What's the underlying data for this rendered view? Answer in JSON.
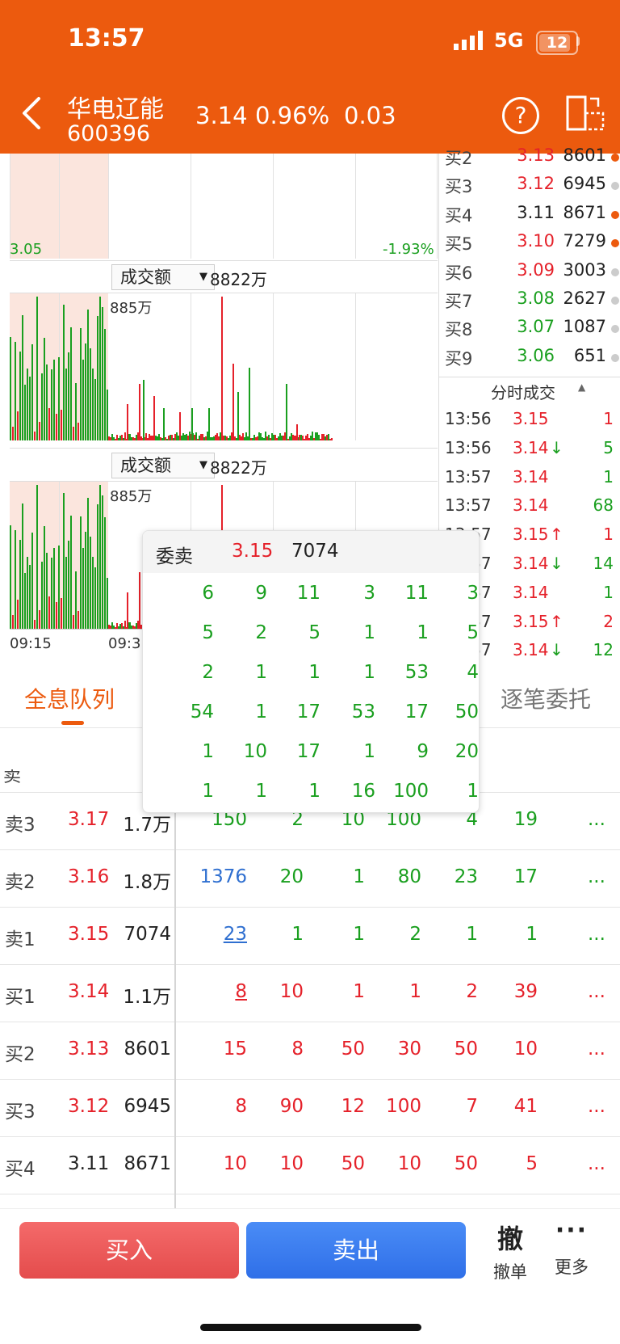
{
  "status": {
    "time": "13:57",
    "network": "5G",
    "battery": "12"
  },
  "stock": {
    "name": "华电辽能",
    "code": "600396",
    "price": "3.14",
    "change_pct": "0.96%",
    "change": "0.03"
  },
  "icons": {
    "back": "back-chevron-icon",
    "help": "help-icon",
    "switch": "landscape-switch-icon"
  },
  "chart": {
    "low_price_label": "3.05",
    "low_pct_label": "-1.93%",
    "indicator_label": "成交额",
    "indicator_value": "8822万",
    "axis_max_label": "885万",
    "time_start": "09:15",
    "time_next": "09:3"
  },
  "orderbook": [
    {
      "label": "买2",
      "price": "3.13",
      "vol": "8601",
      "dot": "#ec5a0e"
    },
    {
      "label": "买3",
      "price": "3.12",
      "vol": "6945",
      "dot": "#cccccc"
    },
    {
      "label": "买4",
      "price": "3.11",
      "vol": "8671",
      "dot": "#ec5a0e"
    },
    {
      "label": "买5",
      "price": "3.10",
      "vol": "7279",
      "dot": "#ec5a0e"
    },
    {
      "label": "买6",
      "price": "3.09",
      "vol": "3003",
      "dot": "#cccccc"
    },
    {
      "label": "买7",
      "price": "3.08",
      "vol": "2627",
      "dot": "#cccccc"
    },
    {
      "label": "买8",
      "price": "3.07",
      "vol": "1087",
      "dot": "#cccccc"
    },
    {
      "label": "买9",
      "price": "3.06",
      "vol": "651",
      "dot": "#cccccc"
    }
  ],
  "ticks_title": "分时成交",
  "ticks": [
    {
      "time": "13:56",
      "price": "3.15",
      "arrow": "",
      "vol": "1",
      "pc": "red",
      "vc": "red"
    },
    {
      "time": "13:56",
      "price": "3.14",
      "arrow": "↓",
      "vol": "5",
      "pc": "red",
      "vc": "green"
    },
    {
      "time": "13:57",
      "price": "3.14",
      "arrow": "",
      "vol": "1",
      "pc": "red",
      "vc": "green"
    },
    {
      "time": "13:57",
      "price": "3.14",
      "arrow": "",
      "vol": "68",
      "pc": "red",
      "vc": "green"
    },
    {
      "time": "13:57",
      "price": "3.15",
      "arrow": "↑",
      "vol": "1",
      "pc": "red",
      "vc": "red"
    },
    {
      "time": "13:57",
      "price": "3.14",
      "arrow": "↓",
      "vol": "14",
      "pc": "red",
      "vc": "green"
    },
    {
      "time": "13:57",
      "price": "3.14",
      "arrow": "",
      "vol": "1",
      "pc": "red",
      "vc": "green"
    },
    {
      "time": "13:57",
      "price": "3.15",
      "arrow": "↑",
      "vol": "2",
      "pc": "red",
      "vc": "red"
    },
    {
      "time": "13:57",
      "price": "3.14",
      "arrow": "↓",
      "vol": "12",
      "pc": "red",
      "vc": "green"
    }
  ],
  "tabs": {
    "left": "全息队列",
    "right": "逐笔委托"
  },
  "queue_rows": [
    {
      "label": "卖3",
      "price": "3.17",
      "pc": "red",
      "vol": "1.7万",
      "cells": [
        "150",
        "2",
        "10",
        "100",
        "4",
        "19"
      ],
      "cc": "green",
      "first": "plain"
    },
    {
      "label": "卖2",
      "price": "3.16",
      "pc": "red",
      "vol": "1.8万",
      "cells": [
        "1376",
        "20",
        "1",
        "80",
        "23",
        "17"
      ],
      "cc": "green",
      "first": "blue"
    },
    {
      "label": "卖1",
      "price": "3.15",
      "pc": "red",
      "vol": "7074",
      "cells": [
        "23",
        "1",
        "1",
        "2",
        "1",
        "1"
      ],
      "cc": "green",
      "first": "blue-u"
    },
    {
      "label": "买1",
      "price": "3.14",
      "pc": "red",
      "vol": "1.1万",
      "cells": [
        "8",
        "10",
        "1",
        "1",
        "2",
        "39"
      ],
      "cc": "red",
      "first": "red-u"
    },
    {
      "label": "买2",
      "price": "3.13",
      "pc": "red",
      "vol": "8601",
      "cells": [
        "15",
        "8",
        "50",
        "30",
        "50",
        "10"
      ],
      "cc": "red",
      "first": "plain"
    },
    {
      "label": "买3",
      "price": "3.12",
      "pc": "red",
      "vol": "6945",
      "cells": [
        "8",
        "90",
        "12",
        "100",
        "7",
        "41"
      ],
      "cc": "red",
      "first": "plain"
    },
    {
      "label": "买4",
      "price": "3.11",
      "pc": "dark",
      "vol": "8671",
      "cells": [
        "10",
        "10",
        "50",
        "10",
        "50",
        "5"
      ],
      "cc": "red",
      "first": "plain"
    }
  ],
  "more_symbol": "...",
  "popup": {
    "label": "委卖",
    "price": "3.15",
    "vol": "7074",
    "rows": [
      [
        "6",
        "9",
        "11",
        "3",
        "11",
        "3"
      ],
      [
        "5",
        "2",
        "5",
        "1",
        "1",
        "5"
      ],
      [
        "2",
        "1",
        "1",
        "1",
        "53",
        "4"
      ],
      [
        "54",
        "1",
        "17",
        "53",
        "17",
        "50"
      ],
      [
        "1",
        "10",
        "17",
        "1",
        "9",
        "20"
      ],
      [
        "1",
        "1",
        "1",
        "16",
        "100",
        "1"
      ]
    ]
  },
  "bottom": {
    "buy": "买入",
    "sell": "卖出",
    "cancel_icon_char": "撤",
    "cancel": "撤单",
    "more": "更多"
  }
}
